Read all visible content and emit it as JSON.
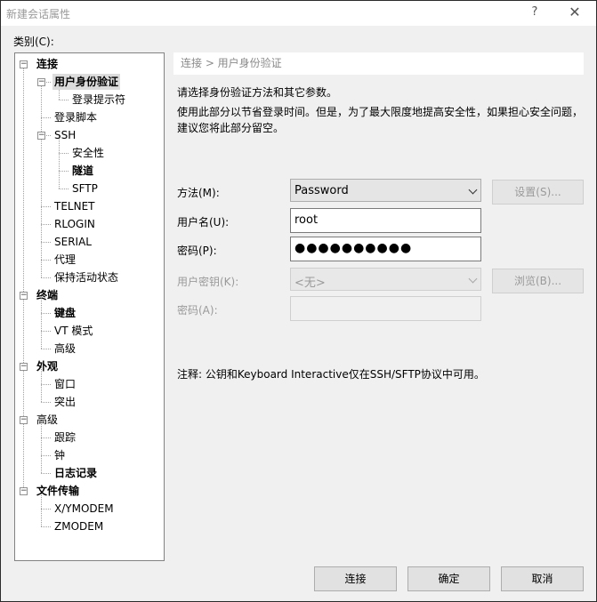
{
  "window": {
    "title": "新建会话属性",
    "help_glyph": "?",
    "close_glyph": "✕"
  },
  "category_label": "类别(C):",
  "tree": [
    {
      "label": "连接",
      "bold": true,
      "toggle": "-"
    },
    {
      "label": "用户身份验证",
      "bold": true,
      "toggle": "-",
      "selected": true
    },
    {
      "label": "登录提示符"
    },
    {
      "label": "登录脚本"
    },
    {
      "label": "SSH",
      "toggle": "-"
    },
    {
      "label": "安全性"
    },
    {
      "label": "隧道",
      "bold": true
    },
    {
      "label": "SFTP"
    },
    {
      "label": "TELNET"
    },
    {
      "label": "RLOGIN"
    },
    {
      "label": "SERIAL"
    },
    {
      "label": "代理"
    },
    {
      "label": "保持活动状态"
    },
    {
      "label": "终端",
      "bold": true,
      "toggle": "-"
    },
    {
      "label": "键盘",
      "bold": true
    },
    {
      "label": "VT 模式"
    },
    {
      "label": "高级"
    },
    {
      "label": "外观",
      "bold": true,
      "toggle": "-"
    },
    {
      "label": "窗口"
    },
    {
      "label": "突出"
    },
    {
      "label": "高级",
      "toggle": "-"
    },
    {
      "label": "跟踪"
    },
    {
      "label": "钟"
    },
    {
      "label": "日志记录",
      "bold": true
    },
    {
      "label": "文件传输",
      "bold": true,
      "toggle": "-"
    },
    {
      "label": "X/YMODEM"
    },
    {
      "label": "ZMODEM"
    }
  ],
  "panel": {
    "breadcrumb": "连接 > 用户身份验证",
    "intro": "请选择身份验证方法和其它参数。",
    "desc_line1": "使用此部分以节省登录时间。但是，为了最大限度地提高安全性，如果担心安全问题，",
    "desc_line2": "建议您将此部分留空。",
    "method_label": "方法(M):",
    "method_value": "Password",
    "settings_button": "设置(S)...",
    "username_label": "用户名(U):",
    "username_value": "root",
    "password_label": "密码(P):",
    "password_value": "●●●●●●●●●●",
    "user_key_label": "用户密钥(K):",
    "user_key_value": "<无>",
    "browse_button": "浏览(B)...",
    "passphrase_label": "密码(A):",
    "passphrase_value": "",
    "note": "注释: 公钥和Keyboard Interactive仅在SSH/SFTP协议中可用。"
  },
  "buttons": {
    "connect": "连接",
    "ok": "确定",
    "cancel": "取消"
  },
  "colors": {
    "dialog_bg": "#f0f0f0",
    "selection_bg": "#dcdcdc",
    "disabled_text": "#9a9a9a"
  }
}
